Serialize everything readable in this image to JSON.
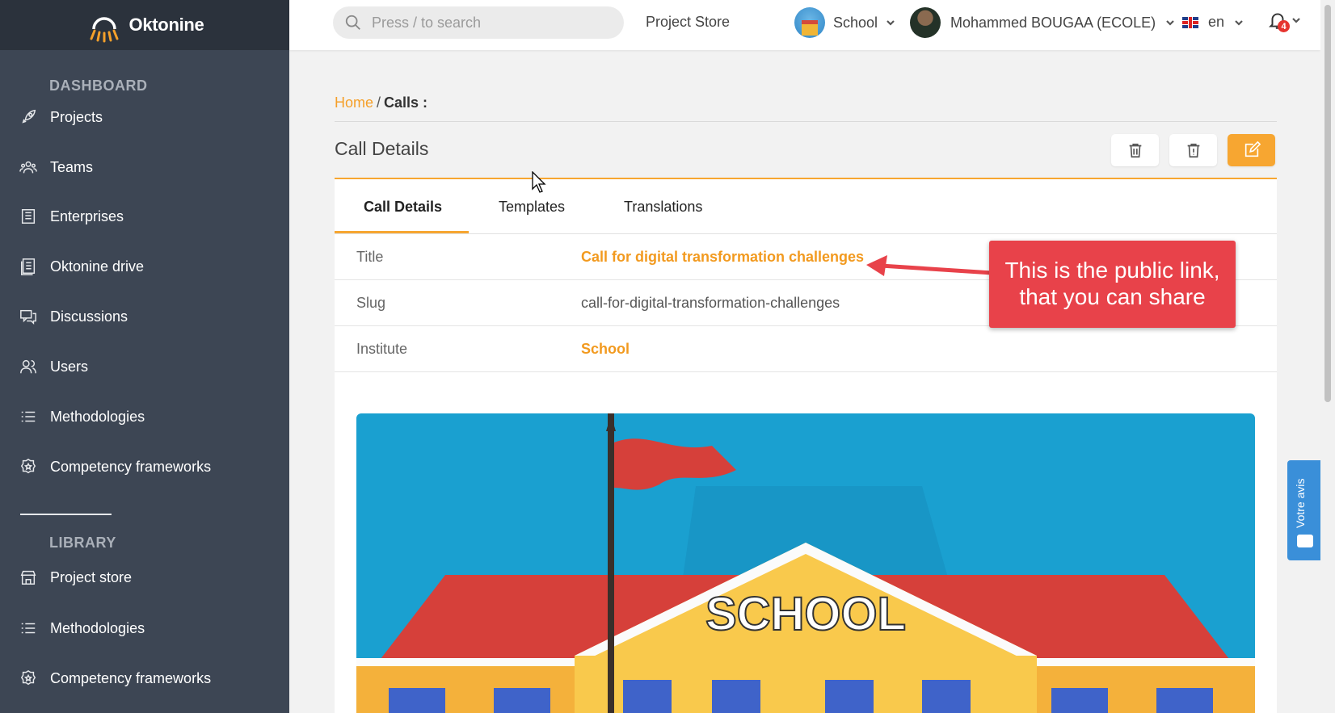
{
  "brand": {
    "name": "Oktonine"
  },
  "sidebar": {
    "dashboard_title": "DASHBOARD",
    "library_title": "LIBRARY",
    "items": [
      {
        "label": "Projects",
        "icon": "rocket-icon"
      },
      {
        "label": "Teams",
        "icon": "team-icon"
      },
      {
        "label": "Enterprises",
        "icon": "enterprise-icon"
      },
      {
        "label": "Oktonine drive",
        "icon": "drive-icon"
      },
      {
        "label": "Discussions",
        "icon": "discussion-icon"
      },
      {
        "label": "Users",
        "icon": "users-icon"
      },
      {
        "label": "Methodologies",
        "icon": "list-icon"
      },
      {
        "label": "Competency frameworks",
        "icon": "badge-icon"
      }
    ],
    "library_items": [
      {
        "label": "Project store",
        "icon": "store-icon"
      },
      {
        "label": "Methodologies",
        "icon": "list-icon"
      },
      {
        "label": "Competency frameworks",
        "icon": "badge-icon"
      }
    ]
  },
  "topbar": {
    "search_placeholder": "Press / to search",
    "project_store": "Project Store",
    "school": "School",
    "user": "Mohammed BOUGAA (ECOLE)",
    "lang": "en",
    "notifications": "4"
  },
  "breadcrumb": {
    "home": "Home",
    "sep": "/",
    "current": "Calls :"
  },
  "page": {
    "title": "Call Details"
  },
  "tabs": [
    {
      "label": "Call Details"
    },
    {
      "label": "Templates"
    },
    {
      "label": "Translations"
    }
  ],
  "details": {
    "title_label": "Title",
    "title_value": "Call for digital transformation challenges",
    "slug_label": "Slug",
    "slug_value": "call-for-digital-transformation-challenges",
    "institute_label": "Institute",
    "institute_value": "School"
  },
  "hero": {
    "sign": "SCHOOL"
  },
  "callout": {
    "line1": "This is the public link,",
    "line2": "that you can share"
  },
  "feedback": {
    "label": "Votre avis"
  },
  "colors": {
    "accent": "#f7a631",
    "sidebar": "#3d4654",
    "callout": "#e8424a",
    "feedback": "#3a8fd9"
  }
}
